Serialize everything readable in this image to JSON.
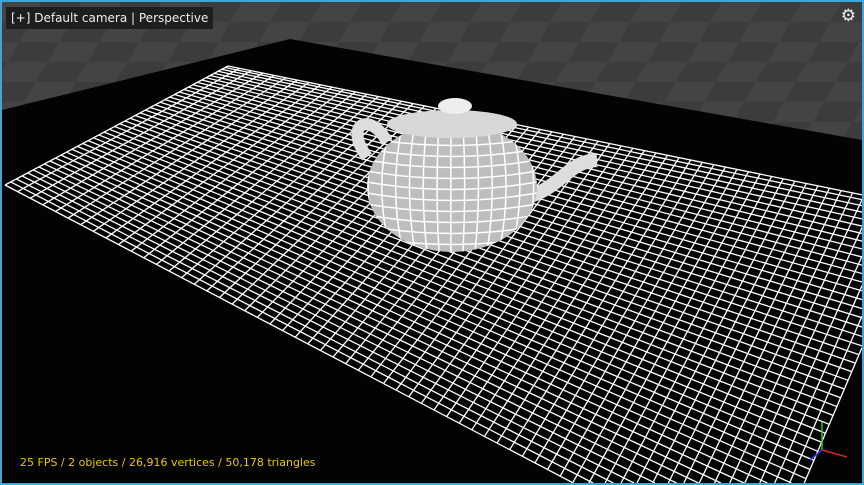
{
  "viewport": {
    "camera_label": "[+] Default camera | Perspective",
    "settings_icon": "gear-icon",
    "stats": "25 FPS / 2 objects / 26,916 vertices / 50,178 triangles"
  },
  "colors": {
    "border": "#3ba7dc",
    "stats": "#e8c700",
    "grid": "#ffffff"
  }
}
